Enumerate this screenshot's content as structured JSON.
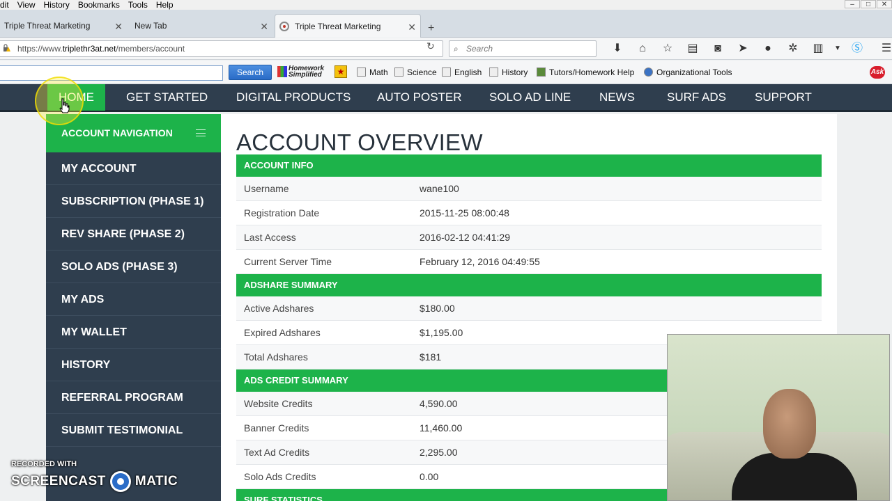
{
  "menubar": {
    "items": [
      "dit",
      "View",
      "History",
      "Bookmarks",
      "Tools",
      "Help"
    ]
  },
  "tabs": [
    {
      "label": "Triple Threat Marketing"
    },
    {
      "label": "New Tab"
    },
    {
      "label": "Triple Threat Marketing"
    }
  ],
  "navbar": {
    "url_scheme": "https://www.",
    "url_host": "triplethr3at.net",
    "url_path": "/members/account",
    "search_placeholder": "Search"
  },
  "bookmarks": {
    "search_button": "Search",
    "homework_logo": "Homework Simplified",
    "items": [
      "Math",
      "Science",
      "English",
      "History",
      "Tutors/Homework Help",
      "Organizational Tools"
    ],
    "ask_logo": "Ask"
  },
  "site_nav": [
    "HOME",
    "GET STARTED",
    "DIGITAL PRODUCTS",
    "AUTO POSTER",
    "SOLO AD LINE",
    "NEWS",
    "SURF ADS",
    "SUPPORT"
  ],
  "left_nav": {
    "header": "ACCOUNT NAVIGATION",
    "items": [
      "MY ACCOUNT",
      "SUBSCRIPTION (PHASE 1)",
      "REV SHARE (PHASE 2)",
      "SOLO ADS (PHASE 3)",
      "MY ADS",
      "MY WALLET",
      "HISTORY",
      "REFERRAL PROGRAM",
      "SUBMIT TESTIMONIAL"
    ]
  },
  "main": {
    "title": "ACCOUNT OVERVIEW",
    "sections": [
      {
        "heading": "ACCOUNT INFO",
        "rows": [
          {
            "label": "Username",
            "value": "wane100"
          },
          {
            "label": "Registration Date",
            "value": "2015-11-25 08:00:48"
          },
          {
            "label": "Last Access",
            "value": "2016-02-12 04:41:29"
          },
          {
            "label": "Current Server Time",
            "value": "February 12, 2016 04:49:55"
          }
        ]
      },
      {
        "heading": "ADSHARE SUMMARY",
        "rows": [
          {
            "label": "Active Adshares",
            "value": "$180.00"
          },
          {
            "label": "Expired Adshares",
            "value": "$1,195.00"
          },
          {
            "label": "Total Adshares",
            "value": "$181"
          }
        ]
      },
      {
        "heading": "ADS CREDIT SUMMARY",
        "rows": [
          {
            "label": "Website Credits",
            "value": "4,590.00"
          },
          {
            "label": "Banner Credits",
            "value": "11,460.00"
          },
          {
            "label": "Text Ad Credits",
            "value": "2,295.00"
          },
          {
            "label": "Solo Ads Credits",
            "value": "0.00"
          }
        ]
      },
      {
        "heading": "SURF STATISTICS",
        "rows": []
      }
    ]
  },
  "watermark": {
    "line1": "RECORDED WITH",
    "left": "SCREENCAST",
    "right": "MATIC"
  },
  "colors": {
    "nav_dark": "#2f3e4e",
    "accent_green": "#1db34a",
    "title": "#27313b"
  }
}
